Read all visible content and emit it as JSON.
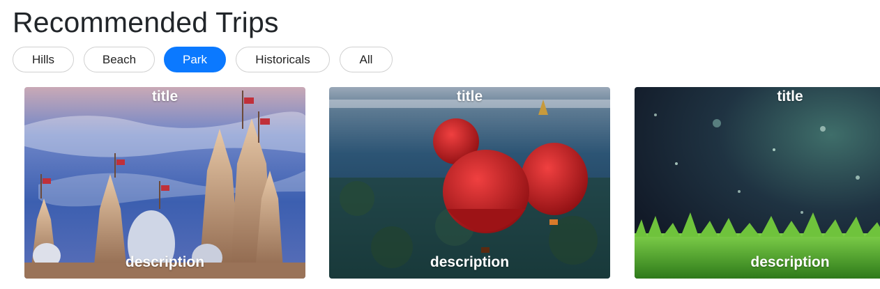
{
  "page": {
    "title": "Recommended Trips"
  },
  "filters": [
    {
      "label": "Hills",
      "active": false
    },
    {
      "label": "Beach",
      "active": false
    },
    {
      "label": "Park",
      "active": true
    },
    {
      "label": "Historicals",
      "active": false
    },
    {
      "label": "All",
      "active": false
    }
  ],
  "colors": {
    "accent": "#0b79ff",
    "pill_border": "#d0d0d0",
    "text": "#212529"
  },
  "cards": [
    {
      "title": "title",
      "description": "description",
      "image": "temple-spires-photo"
    },
    {
      "title": "title",
      "description": "description",
      "image": "hot-air-balloons-photo"
    },
    {
      "title": "title",
      "description": "description",
      "image": "rainy-grass-photo"
    }
  ]
}
